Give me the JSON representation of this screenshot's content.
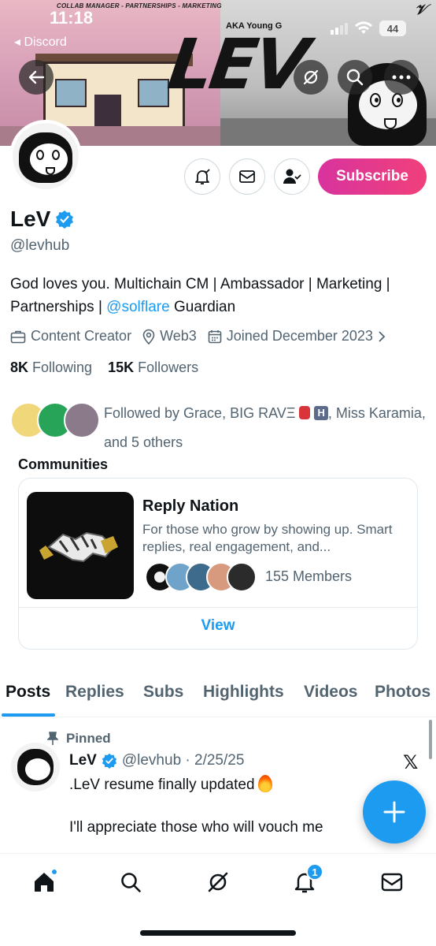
{
  "status_bar": {
    "time": "11:18",
    "back_app": "Discord",
    "battery": "44"
  },
  "banner": {
    "top_text": "COLLAB MANAGER - PARTNERSHIPS - MARKETING",
    "aka_text": "AKA Young G",
    "logo_text": "LEV"
  },
  "profile": {
    "name": "LeV",
    "handle": "@levhub",
    "subscribe_label": "Subscribe",
    "bio_before": "God loves you. Multichain CM | Ambassador | Marketing | Partnerships | ",
    "bio_link": "@solflare",
    "bio_after": " Guardian",
    "category": "Content Creator",
    "location": "Web3",
    "joined": "Joined December 2023",
    "following_count": "8K",
    "following_label": "Following",
    "followers_count": "15K",
    "followers_label": "Followers",
    "followed_by_1": "Followed by Grace, BIG RAVΞ",
    "followed_by_h": "H",
    "followed_by_2": ", Miss Karamia, and 5 others"
  },
  "communities": {
    "heading": "Communities",
    "name": "Reply Nation",
    "description": "For those who grow by showing up. Smart replies, real engagement, and...",
    "members": "155 Members",
    "view_label": "View"
  },
  "tabs": [
    "Posts",
    "Replies",
    "Subs",
    "Highlights",
    "Videos",
    "Photos"
  ],
  "post": {
    "pinned_label": "Pinned",
    "author": "LeV",
    "handle_date": "@levhub · 2/25/25",
    "line1": ".LeV resume finally updated",
    "line2": "I'll appreciate those who will vouch me"
  },
  "nav": {
    "notifications_count": "1"
  },
  "colors": {
    "accent": "#1d9bf0",
    "subscribe_start": "#d8339e",
    "subscribe_end": "#f0407a",
    "text_secondary": "#536471"
  },
  "icons": [
    "back-arrow-icon",
    "grok-icon",
    "search-icon",
    "more-icon",
    "bell-check-icon",
    "mail-icon",
    "person-check-icon",
    "verified-badge-icon",
    "briefcase-icon",
    "location-icon",
    "calendar-icon",
    "chevron-right-icon",
    "pin-icon",
    "x-logo-icon",
    "plus-icon",
    "home-icon",
    "bell-icon"
  ]
}
